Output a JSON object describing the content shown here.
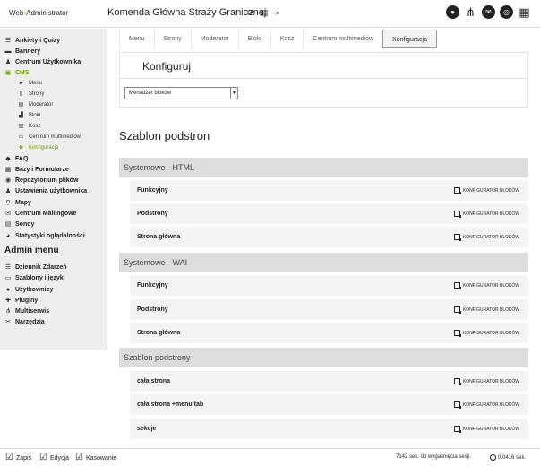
{
  "header": {
    "logo_prefix": "Web",
    "logo_dot": "•",
    "logo_suffix": "Administrator",
    "title": "Komenda Główna Straży Granicznej",
    "title_icons": [
      "refresh-icon",
      "list-icon",
      "search-icon"
    ],
    "right_icons": [
      "user-icon",
      "share-icon",
      "mail-icon",
      "help-lifebuoy-icon",
      "grid-icon"
    ]
  },
  "sidebar": {
    "items": [
      {
        "label": "Ankiety i Quizy",
        "icon": "list-icon"
      },
      {
        "label": "Bannery",
        "icon": "banner-icon"
      },
      {
        "label": "Centrum Użytkownika",
        "icon": "users-icon"
      },
      {
        "label": "CMS",
        "icon": "cms-icon",
        "active": true
      },
      {
        "label": "FAQ",
        "icon": "faq-icon"
      },
      {
        "label": "Bazy i Formularze",
        "icon": "database-icon"
      },
      {
        "label": "Repozytorium plików",
        "icon": "eye-icon"
      },
      {
        "label": "Ustawienia użytkownika",
        "icon": "user-settings-icon"
      },
      {
        "label": "Mapy",
        "icon": "map-pin-icon"
      },
      {
        "label": "Centrum Mailingowe",
        "icon": "mail-icon"
      },
      {
        "label": "Sondy",
        "icon": "poll-icon"
      },
      {
        "label": "Statystyki oglądalności",
        "icon": "pie-chart-icon"
      }
    ],
    "cms_sub": [
      {
        "label": "Menu",
        "icon": "folder-icon"
      },
      {
        "label": "Strony",
        "icon": "page-icon"
      },
      {
        "label": "Moderator",
        "icon": "moderator-icon"
      },
      {
        "label": "Bloki",
        "icon": "blocks-icon"
      },
      {
        "label": "Kosz",
        "icon": "trash-icon"
      },
      {
        "label": "Centrum multimediów",
        "icon": "media-icon"
      },
      {
        "label": "Konfiguracja",
        "icon": "gear-icon",
        "active": true
      }
    ],
    "admin_title": "Admin menu",
    "admin_items": [
      {
        "label": "Dziennik Zdarzeń",
        "icon": "log-icon"
      },
      {
        "label": "Szablony i języki",
        "icon": "templates-icon"
      },
      {
        "label": "Użytkownicy",
        "icon": "users-icon"
      },
      {
        "label": "Pluginy",
        "icon": "plugin-icon"
      },
      {
        "label": "Multiserwis",
        "icon": "share-icon"
      },
      {
        "label": "Narzędzia",
        "icon": "tools-icon"
      }
    ]
  },
  "tabs": [
    {
      "label": "Menu"
    },
    {
      "label": "Strony"
    },
    {
      "label": "Moderator"
    },
    {
      "label": "Bloki"
    },
    {
      "label": "Kosz"
    },
    {
      "label": "Centrum multimediów"
    },
    {
      "label": "Konfiguracja",
      "active": true
    }
  ],
  "konfiguruj": {
    "title": "Konfiguruj",
    "select_value": "Menadżer bloków"
  },
  "main": {
    "heading": "Szablon podstron",
    "groups": [
      {
        "title": "Systemowe - HTML",
        "rows": [
          {
            "name": "Funkcyjny",
            "action": "KONFIGURATOR BLOKÓW"
          },
          {
            "name": "Podstrony",
            "action": "KONFIGURATOR BLOKÓW"
          },
          {
            "name": "Strona główna",
            "action": "KONFIGURATOR BLOKÓW"
          }
        ]
      },
      {
        "title": "Systemowe - WAI",
        "rows": [
          {
            "name": "Funkcyjny",
            "action": "KONFIGURATOR BLOKÓW"
          },
          {
            "name": "Podstrony",
            "action": "KONFIGURATOR BLOKÓW"
          },
          {
            "name": "Strona główna",
            "action": "KONFIGURATOR BLOKÓW"
          }
        ]
      },
      {
        "title": "Szablon podstrony",
        "rows": [
          {
            "name": "cała strona",
            "action": "KONFIGURATOR BLOKÓW"
          },
          {
            "name": "cała strona +menu tab",
            "action": "KONFIGURATOR BLOKÓW"
          },
          {
            "name": "sekcje",
            "action": "KONFIGURATOR BLOKÓW"
          }
        ]
      }
    ]
  },
  "footer": {
    "checks": [
      "Zapis",
      "Edycja",
      "Kasowanie"
    ],
    "session": "7142 sek. do wygaśnięcia sesji.",
    "time": "0.0416 sek."
  }
}
